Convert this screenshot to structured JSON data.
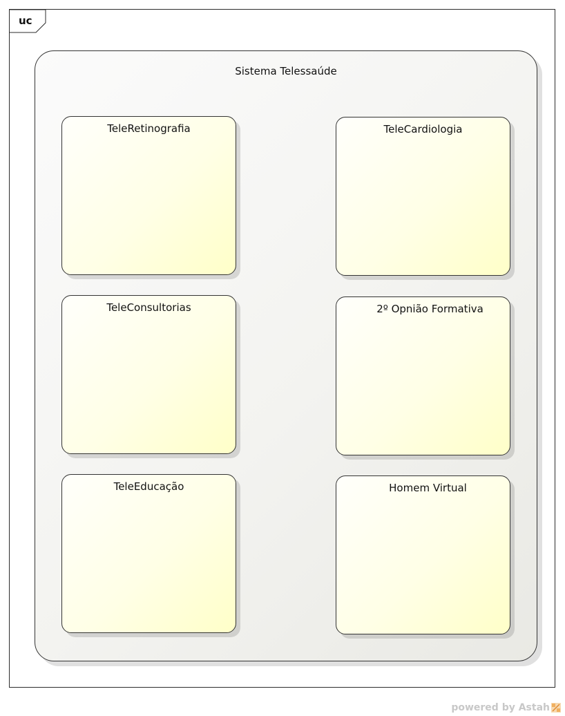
{
  "frame": {
    "label": "uc"
  },
  "system": {
    "title": "Sistema Telessaúde"
  },
  "packages": [
    {
      "title": "TeleRetinografia"
    },
    {
      "title": "TeleCardiologia"
    },
    {
      "title": "TeleConsultorias"
    },
    {
      "title": "2º Opnião Formativa"
    },
    {
      "title": "TeleEducação"
    },
    {
      "title": "Homem Virtual"
    }
  ],
  "watermark": {
    "text": "powered by Astah",
    "logo_icon": "astah-logo-icon"
  },
  "colors": {
    "package_fill": "#ffffd9",
    "system_fill": "#f4f4f1",
    "watermark": "#c8c8c8",
    "logo_accent": "#f0b060"
  }
}
